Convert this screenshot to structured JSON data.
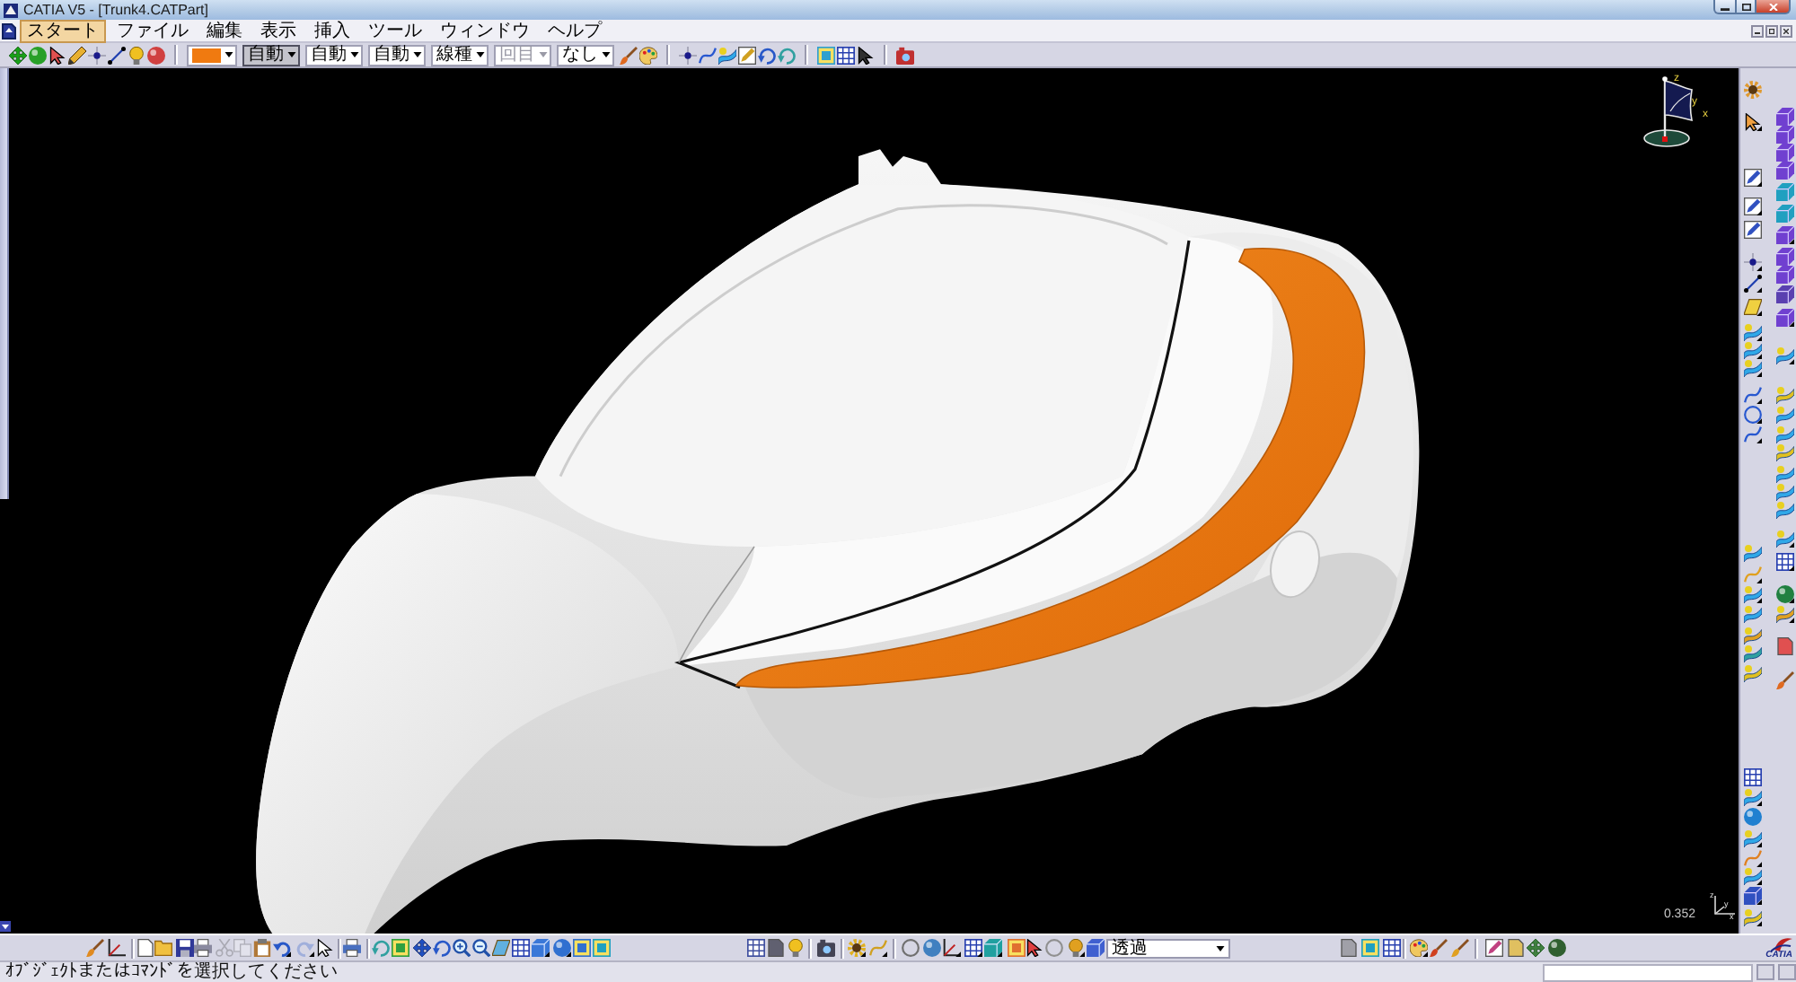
{
  "window": {
    "title": "CATIA V5 - [Trunk4.CATPart]"
  },
  "menu_bar": [
    {
      "label": "スタート",
      "selected": true
    },
    {
      "label": "ファイル",
      "selected": false
    },
    {
      "label": "編集",
      "selected": false
    },
    {
      "label": "表示",
      "selected": false
    },
    {
      "label": "挿入",
      "selected": false
    },
    {
      "label": "ツール",
      "selected": false
    },
    {
      "label": "ウィンドウ",
      "selected": false
    },
    {
      "label": "ヘルプ",
      "selected": false
    }
  ],
  "graphic_properties": {
    "fields": [
      {
        "value": "自動",
        "focused": true,
        "disabled": false
      },
      {
        "value": "自動",
        "focused": false,
        "disabled": false
      },
      {
        "value": "自動",
        "focused": false,
        "disabled": false
      },
      {
        "value": "線種",
        "focused": false,
        "disabled": false
      },
      {
        "value": "回目",
        "focused": false,
        "disabled": true
      },
      {
        "value": "なし",
        "focused": false,
        "disabled": false
      }
    ]
  },
  "viewport": {
    "compass_labels": [
      "z",
      "y",
      "x"
    ],
    "zoom_reading": "0.352",
    "triad_labels": [
      "z",
      "y",
      "x"
    ]
  },
  "bottom_toolbar": {
    "edit_buttons": [
      {
        "disabled": true
      },
      {
        "disabled": true
      },
      {
        "disabled": false
      },
      {
        "disabled": false
      },
      {
        "disabled": true
      }
    ],
    "render_style": "透過"
  },
  "brand": "CATIA",
  "status_bar": {
    "message": "ｵﾌﾞｼﾞｪｸﾄまたはｺﾏﾝﾄﾞを選択してください"
  }
}
